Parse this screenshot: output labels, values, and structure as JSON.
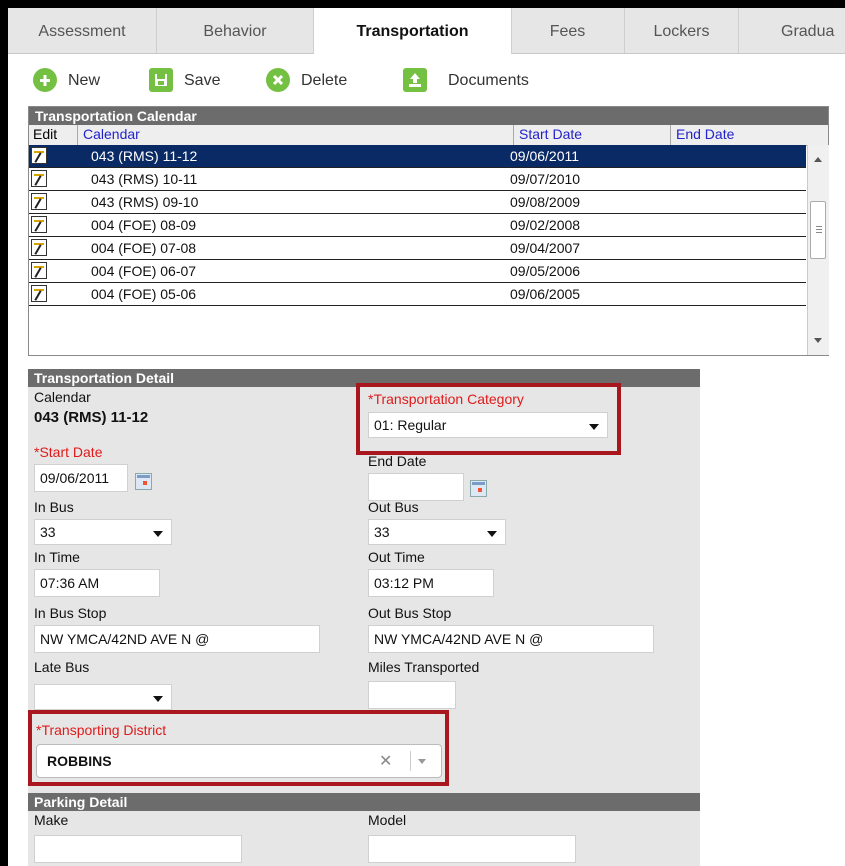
{
  "tabs": [
    "Assessment",
    "Behavior",
    "Transportation",
    "Fees",
    "Lockers",
    "Gradua"
  ],
  "toolbar": {
    "new": "New",
    "save": "Save",
    "delete": "Delete",
    "documents": "Documents"
  },
  "calendar_grid": {
    "title": "Transportation Calendar",
    "headers": {
      "edit": "Edit",
      "calendar": "Calendar",
      "start": "Start Date",
      "end": "End Date"
    },
    "rows": [
      {
        "calendar": "043 (RMS) 11-12",
        "start": "09/06/2011",
        "end": "",
        "selected": true
      },
      {
        "calendar": "043 (RMS) 10-11",
        "start": "09/07/2010",
        "end": ""
      },
      {
        "calendar": "043 (RMS) 09-10",
        "start": "09/08/2009",
        "end": ""
      },
      {
        "calendar": "004 (FOE) 08-09",
        "start": "09/02/2008",
        "end": ""
      },
      {
        "calendar": "004 (FOE) 07-08",
        "start": "09/04/2007",
        "end": ""
      },
      {
        "calendar": "004 (FOE) 06-07",
        "start": "09/05/2006",
        "end": ""
      },
      {
        "calendar": "004 (FOE) 05-06",
        "start": "09/06/2005",
        "end": ""
      }
    ]
  },
  "detail": {
    "title": "Transportation Detail",
    "calendar_label": "Calendar",
    "calendar_value": "043 (RMS) 11-12",
    "category_label": "*Transportation Category",
    "category_value": "01: Regular",
    "start_label": "*Start Date",
    "start_value": "09/06/2011",
    "end_label": "End Date",
    "end_value": "",
    "in_bus_label": "In Bus",
    "in_bus_value": "33",
    "out_bus_label": "Out Bus",
    "out_bus_value": "33",
    "in_time_label": "In Time",
    "in_time_value": "07:36 AM",
    "out_time_label": "Out Time",
    "out_time_value": "03:12 PM",
    "in_stop_label": "In Bus Stop",
    "in_stop_value": "NW YMCA/42ND AVE N @",
    "out_stop_label": "Out Bus Stop",
    "out_stop_value": "NW YMCA/42ND AVE N @",
    "late_bus_label": "Late Bus",
    "late_bus_value": "",
    "miles_label": "Miles Transported",
    "miles_value": "",
    "district_label": "*Transporting District",
    "district_value": "ROBBINS"
  },
  "parking": {
    "title": "Parking Detail",
    "make_label": "Make",
    "model_label": "Model",
    "make_value": "",
    "model_value": ""
  },
  "colors": {
    "required": "#e01a1a",
    "highlight_box": "#a8161e",
    "selected_row": "#0a2a66",
    "button_green": "#74c043"
  }
}
